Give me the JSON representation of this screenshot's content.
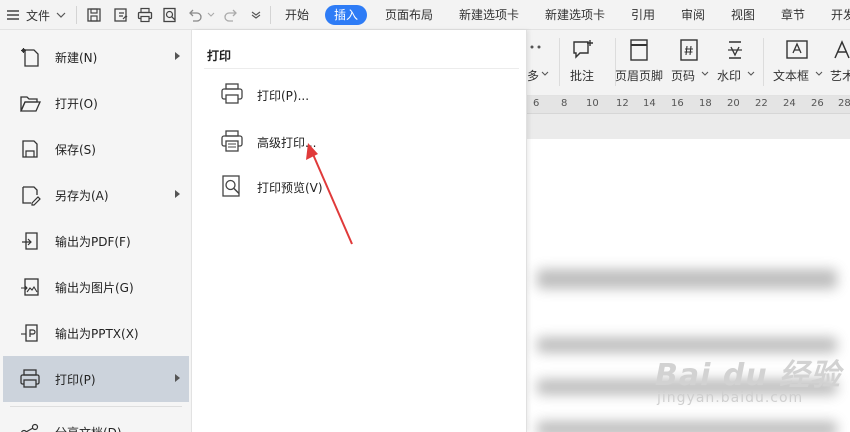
{
  "topbar": {
    "menu_label": "文件",
    "tabs": [
      {
        "label": "开始"
      },
      {
        "label": "插入",
        "active": true
      },
      {
        "label": "页面布局"
      },
      {
        "label": "新建选项卡"
      },
      {
        "label": "新建选项卡"
      },
      {
        "label": "引用"
      },
      {
        "label": "审阅"
      },
      {
        "label": "视图"
      },
      {
        "label": "章节"
      },
      {
        "label": "开发"
      }
    ]
  },
  "ribbon": {
    "partial_label": "多",
    "items": [
      {
        "label": "批注",
        "icon": "comment-icon"
      },
      {
        "label": "页眉页脚",
        "icon": "header-footer-icon"
      },
      {
        "label": "页码",
        "icon": "page-number-icon"
      },
      {
        "label": "水印",
        "icon": "watermark-icon"
      },
      {
        "label": "文本框",
        "icon": "textbox-icon"
      },
      {
        "label": "艺术",
        "icon": "wordart-icon"
      }
    ]
  },
  "ruler": {
    "ticks": [
      "6",
      "8",
      "10",
      "12",
      "14",
      "16",
      "18",
      "20",
      "22",
      "24",
      "26",
      "28"
    ]
  },
  "file_menu": {
    "items": [
      {
        "label": "新建(N)",
        "icon": "new-doc-icon",
        "has_submenu": true
      },
      {
        "label": "打开(O)",
        "icon": "folder-open-icon"
      },
      {
        "label": "保存(S)",
        "icon": "save-icon"
      },
      {
        "label": "另存为(A)",
        "icon": "save-as-icon",
        "has_submenu": true
      },
      {
        "label": "输出为PDF(F)",
        "icon": "export-pdf-icon"
      },
      {
        "label": "输出为图片(G)",
        "icon": "export-image-icon"
      },
      {
        "label": "输出为PPTX(X)",
        "icon": "export-pptx-icon"
      },
      {
        "label": "打印(P)",
        "icon": "printer-icon",
        "has_submenu": true,
        "selected": true
      },
      {
        "label": "分享文档(D)",
        "icon": "share-icon"
      }
    ]
  },
  "print_submenu": {
    "title": "打印",
    "items": [
      {
        "label": "打印(P)...",
        "icon": "printer-icon"
      },
      {
        "label": "高级打印...",
        "icon": "advanced-print-icon"
      },
      {
        "label": "打印预览(V)",
        "icon": "print-preview-icon"
      }
    ]
  },
  "watermark": {
    "main": "Bai du 经验",
    "sub": "jingyan.baidu.com"
  },
  "colors": {
    "accent": "#2e7cf6",
    "selected_row": "#ccd3dc",
    "annotation_arrow": "#e03a3a"
  }
}
